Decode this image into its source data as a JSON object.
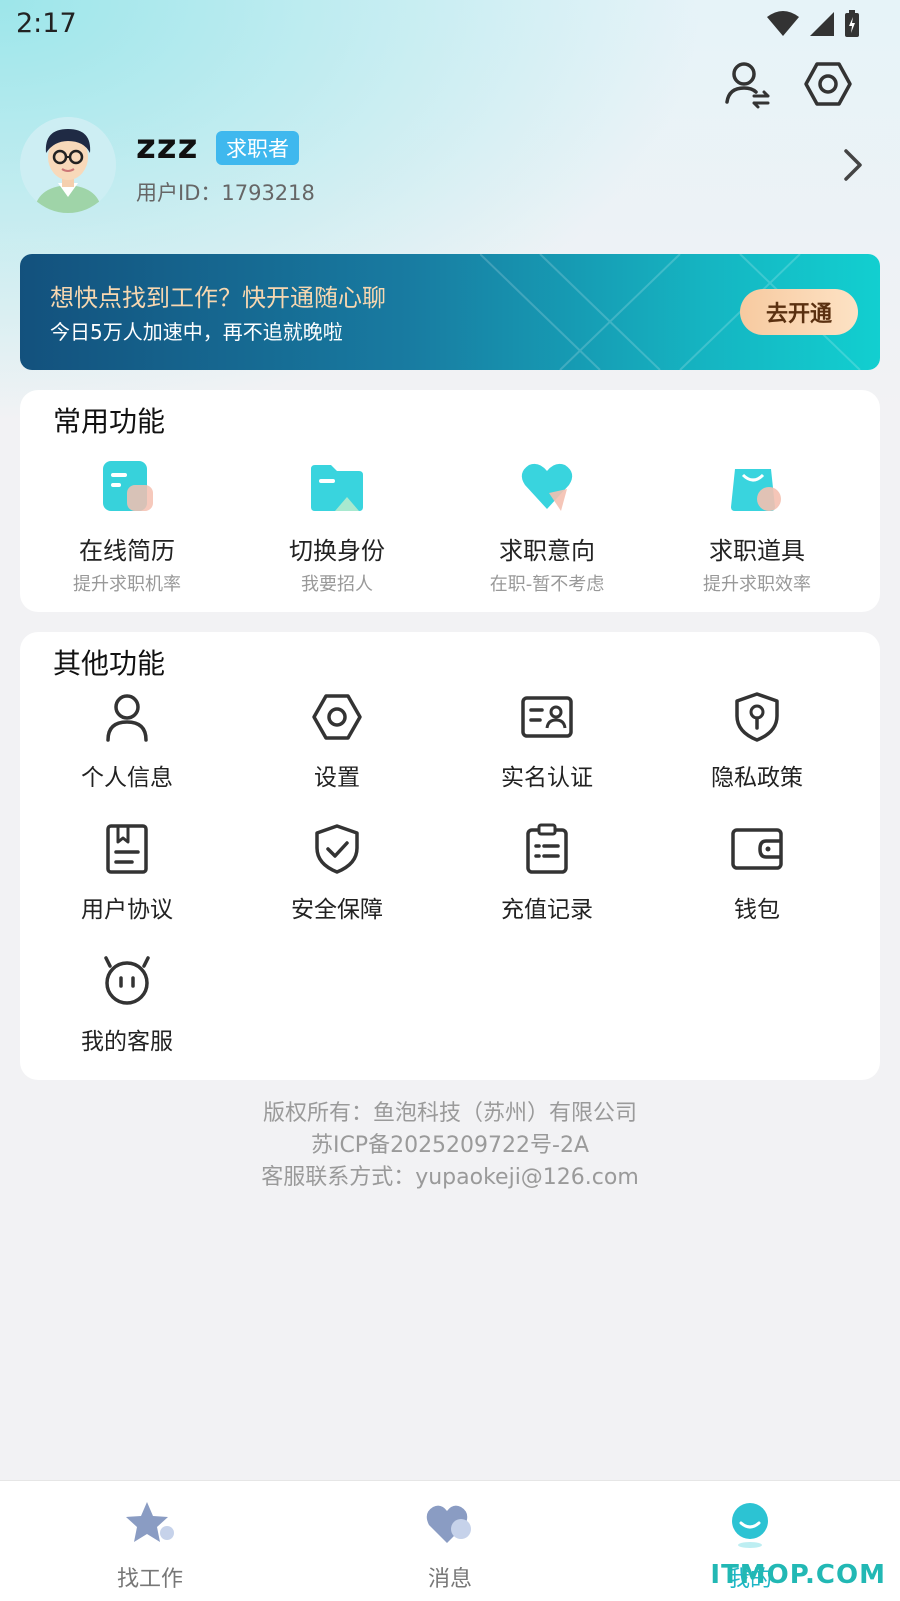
{
  "status_bar": {
    "time": "2:17"
  },
  "profile": {
    "name": "zzz",
    "role": "求职者",
    "user_id": "用户ID：1793218"
  },
  "vip_banner": {
    "title": "想快点找到工作？快开通随心聊",
    "subtitle": "今日5万人加速中，再不追就晚啦",
    "button": "去开通"
  },
  "common_functions": {
    "title": "常用功能",
    "items": [
      {
        "label": "在线简历",
        "sub": "提升求职机率",
        "icon": "resume-icon"
      },
      {
        "label": "切换身份",
        "sub": "我要招人",
        "icon": "folder-icon"
      },
      {
        "label": "求职意向",
        "sub": "在职-暂不考虑",
        "icon": "heart-icon"
      },
      {
        "label": "求职道具",
        "sub": "提升求职效率",
        "icon": "shopping-bag-icon"
      }
    ]
  },
  "other_functions": {
    "title": "其他功能",
    "items": [
      {
        "label": "个人信息",
        "icon": "user-icon"
      },
      {
        "label": "设置",
        "icon": "hex-settings-icon"
      },
      {
        "label": "实名认证",
        "icon": "id-card-icon"
      },
      {
        "label": "隐私政策",
        "icon": "privacy-shield-icon"
      },
      {
        "label": "用户协议",
        "icon": "agreement-book-icon"
      },
      {
        "label": "安全保障",
        "icon": "shield-check-icon"
      },
      {
        "label": "充值记录",
        "icon": "clipboard-list-icon"
      },
      {
        "label": "钱包",
        "icon": "wallet-icon"
      },
      {
        "label": "我的客服",
        "icon": "customer-service-icon"
      }
    ]
  },
  "footer": {
    "copyright": "版权所有：鱼泡科技（苏州）有限公司",
    "icp": "苏ICP备2025209722号-2A",
    "contact": "客服联系方式：yupaokeji@126.com"
  },
  "tabbar": {
    "items": [
      {
        "label": "找工作",
        "icon": "star-icon"
      },
      {
        "label": "消息",
        "icon": "message-heart-icon"
      },
      {
        "label": "我的",
        "icon": "profile-smile-icon",
        "active": true
      }
    ]
  },
  "watermark": "ITMOP.COM",
  "colors": {
    "accent": "#1fb6c6",
    "badge": "#3fb8ee",
    "banner_title": "#f7d7b0"
  }
}
